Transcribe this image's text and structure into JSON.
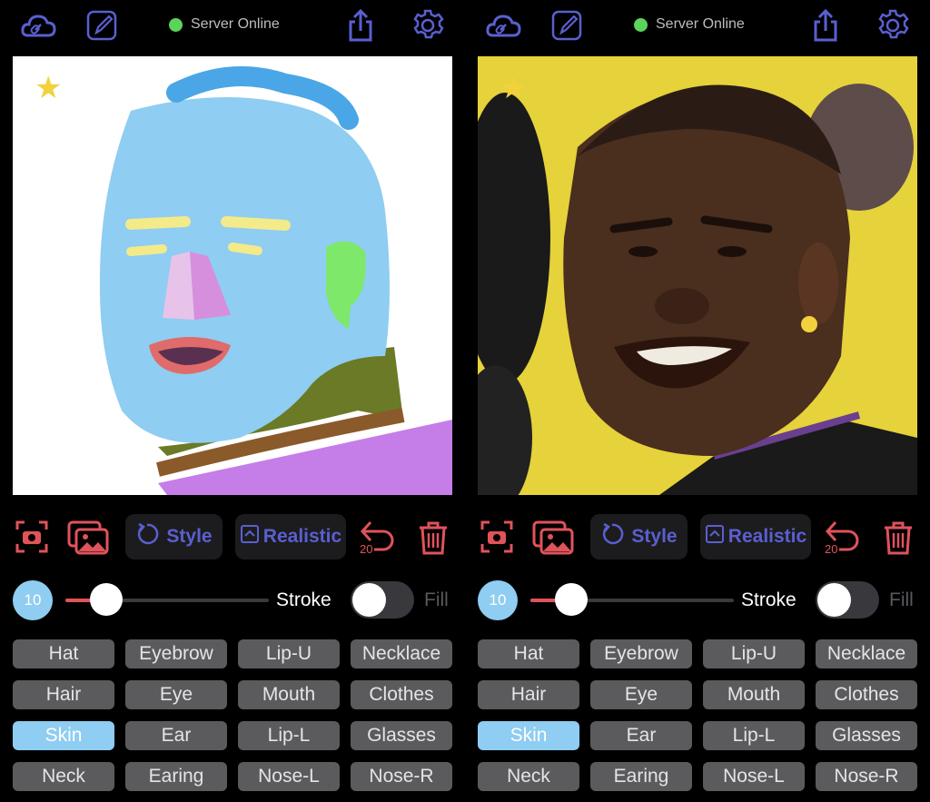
{
  "panels": [
    {
      "id": "sketch",
      "status": "Server Online",
      "style_label": "Style",
      "realistic_label": "Realistic",
      "undo_count": "20",
      "stroke_size": "10",
      "stroke_slider_fraction": 0.2,
      "stroke_label": "Stroke",
      "fill_label": "Fill",
      "fill_on": false,
      "selected_part": "Skin",
      "parts": [
        "Hat",
        "Eyebrow",
        "Lip-U",
        "Necklace",
        "Hair",
        "Eye",
        "Mouth",
        "Clothes",
        "Skin",
        "Ear",
        "Lip-L",
        "Glasses",
        "Neck",
        "Earing",
        "Nose-L",
        "Nose-R"
      ]
    },
    {
      "id": "photo",
      "status": "Server Online",
      "style_label": "Style",
      "realistic_label": "Realistic",
      "undo_count": "20",
      "stroke_size": "10",
      "stroke_slider_fraction": 0.2,
      "stroke_label": "Stroke",
      "fill_label": "Fill",
      "fill_on": false,
      "selected_part": "Skin",
      "parts": [
        "Hat",
        "Eyebrow",
        "Lip-U",
        "Necklace",
        "Hair",
        "Eye",
        "Mouth",
        "Clothes",
        "Skin",
        "Ear",
        "Lip-L",
        "Glasses",
        "Neck",
        "Earing",
        "Nose-L",
        "Nose-R"
      ]
    }
  ],
  "colors": {
    "accent": "#5a5fd0",
    "danger": "#e0535b",
    "online": "#5bd45b",
    "selected": "#8fcdf2",
    "button": "#5b5b5e"
  },
  "icons": [
    "cloud-link-icon",
    "edit-brush-icon",
    "share-icon",
    "gear-icon",
    "camera-scan-icon",
    "gallery-icon",
    "rotate-icon",
    "collapse-icon",
    "undo-icon",
    "trash-icon",
    "star-icon"
  ]
}
